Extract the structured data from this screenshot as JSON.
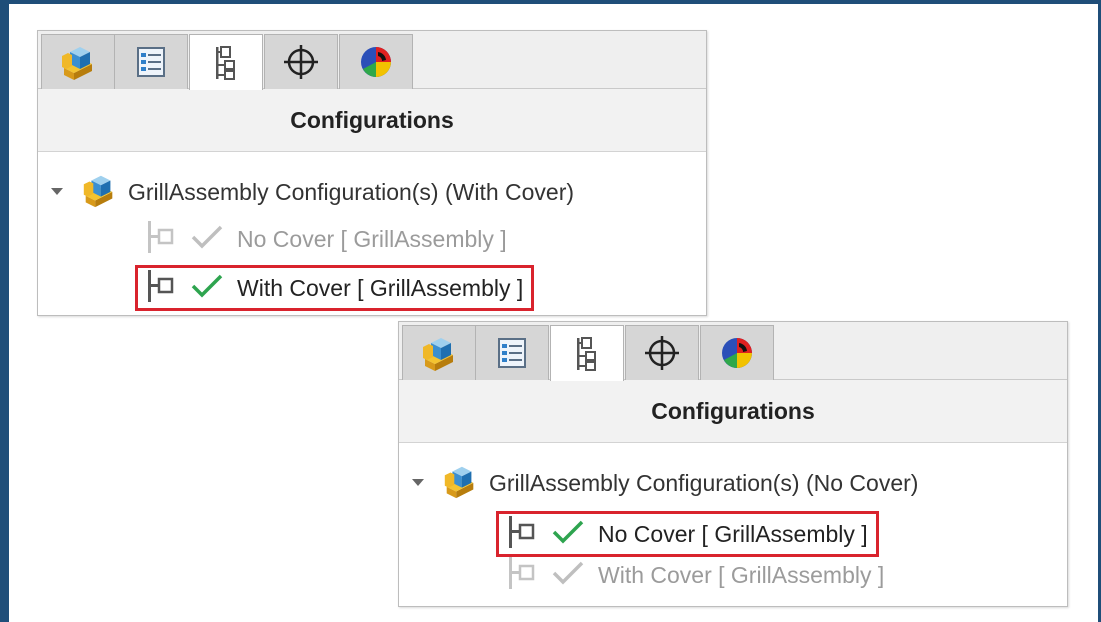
{
  "colors": {
    "frame": "#1f4e79",
    "highlight_box": "#d9232d",
    "active_check": "#2ea44f",
    "inactive_check": "#bfbfbf",
    "inactive_text": "#9b9b9b"
  },
  "tab_icons": [
    "feature-manager-icon",
    "property-manager-icon",
    "configuration-manager-icon",
    "dimxpert-manager-icon",
    "display-manager-icon"
  ],
  "panel_top": {
    "heading": "Configurations",
    "active_tab": "configuration-manager",
    "tree": {
      "root_label": "GrillAssembly Configuration(s)  (With Cover)",
      "items": [
        {
          "label": "No Cover [ GrillAssembly ]",
          "active": false
        },
        {
          "label": "With Cover [ GrillAssembly ]",
          "active": true,
          "highlighted": true
        }
      ]
    }
  },
  "panel_bottom": {
    "heading": "Configurations",
    "active_tab": "configuration-manager",
    "tree": {
      "root_label": "GrillAssembly Configuration(s)  (No Cover)",
      "items": [
        {
          "label": "No Cover [ GrillAssembly ]",
          "active": true,
          "highlighted": true
        },
        {
          "label": "With Cover [ GrillAssembly ]",
          "active": false
        }
      ]
    }
  }
}
